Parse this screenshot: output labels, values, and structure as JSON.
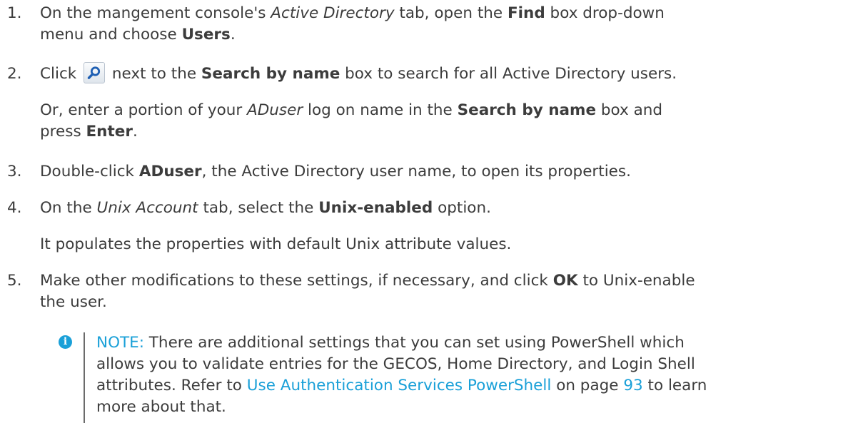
{
  "steps": [
    {
      "number": "1.",
      "line1_a": "On the mangement console's ",
      "line1_em": "Active Directory",
      "line1_b": " tab, open the ",
      "line1_bold": "Find",
      "line1_c": " box drop-down",
      "line2_a": "menu and choose ",
      "line2_bold": "Users",
      "line2_b": "."
    },
    {
      "number": "2.",
      "line1_a": "Click",
      "line1_b": " next to the ",
      "line1_bold": "Search by name",
      "line1_c": " box to search for all Active Directory users.",
      "para_a": "Or, enter a portion of your ",
      "para_em": "ADuser",
      "para_b": " log on name in the ",
      "para_bold": "Search by name",
      "para_c": " box and",
      "para2_a": "press ",
      "para2_bold": "Enter",
      "para2_b": "."
    },
    {
      "number": "3.",
      "a": "Double-click ",
      "bold": "ADuser",
      "b": ", the Active Directory user name, to open its properties."
    },
    {
      "number": "4.",
      "a": "On the ",
      "em": "Unix Account",
      "b": " tab, select the ",
      "bold": "Unix-enabled",
      "c": " option.",
      "para": "It populates the properties with default Unix attribute values."
    },
    {
      "number": "5.",
      "line1_a": "Make other modifications to these settings, if necessary, and click ",
      "line1_bold": "OK",
      "line1_b": " to Unix-enable",
      "line2": "the user."
    }
  ],
  "note": {
    "icon": "info-icon",
    "label": "NOTE:",
    "text_a": " There are additional settings that you can set using PowerShell which",
    "line2": "allows you to validate entries for the GECOS, Home Directory, and Login Shell",
    "line3_a": "attributes. Refer to ",
    "link_text": "Use Authentication Services PowerShell",
    "line3_b": " on page ",
    "page_link": "93",
    "line3_c": " to learn",
    "line4": "more about that."
  },
  "colors": {
    "text": "#3c3c3c",
    "link": "#1aa0d8",
    "note_bar": "#6b6b6b"
  },
  "icons": {
    "search_button": "search-icon"
  }
}
